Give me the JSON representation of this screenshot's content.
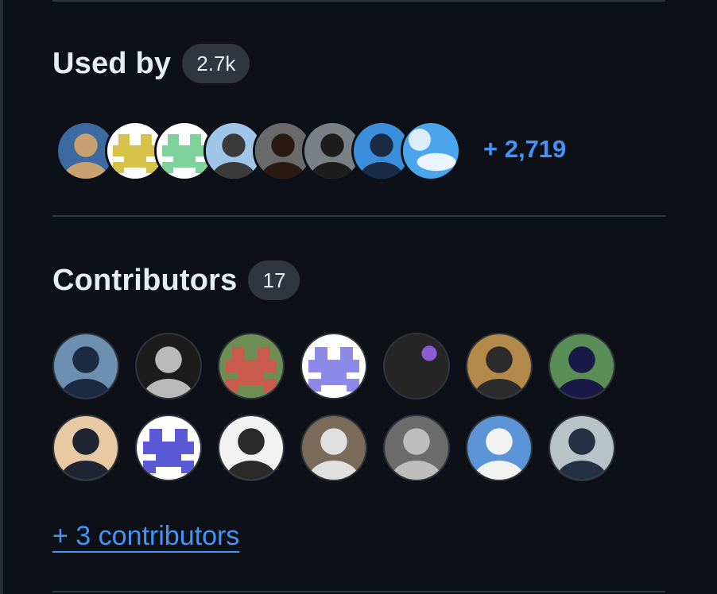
{
  "used_by": {
    "title": "Used by",
    "count_badge": "2.7k",
    "more_link": "+ 2,719",
    "avatars": [
      {
        "name": "user-avatar-1",
        "colors": [
          "#3c6aa0",
          "#c9a070"
        ]
      },
      {
        "name": "user-avatar-2",
        "colors": [
          "#ffffff",
          "#d6c24a"
        ]
      },
      {
        "name": "user-avatar-3",
        "colors": [
          "#ffffff",
          "#7fd39a"
        ]
      },
      {
        "name": "user-avatar-4",
        "colors": [
          "#9fc6e8",
          "#3a3a3a"
        ]
      },
      {
        "name": "user-avatar-5",
        "colors": [
          "#6a6a6a",
          "#2a1a12"
        ]
      },
      {
        "name": "user-avatar-6",
        "colors": [
          "#7b7f86",
          "#1d1d1d"
        ]
      },
      {
        "name": "user-avatar-7",
        "colors": [
          "#3a8edb",
          "#1b2b45"
        ]
      },
      {
        "name": "user-avatar-8",
        "colors": [
          "#4aa5ea",
          "#e9f4ff"
        ]
      }
    ]
  },
  "contributors": {
    "title": "Contributors",
    "count_badge": "17",
    "more_link": "+ 3 contributors",
    "avatars": [
      {
        "name": "contributor-avatar-1",
        "colors": [
          "#6d8fb0",
          "#1c2a44"
        ]
      },
      {
        "name": "contributor-avatar-2",
        "colors": [
          "#1c1c1c",
          "#b9b9b9"
        ]
      },
      {
        "name": "contributor-avatar-3",
        "colors": [
          "#6e8e55",
          "#c85b4b"
        ]
      },
      {
        "name": "contributor-avatar-4",
        "colors": [
          "#ffffff",
          "#8c8ae6"
        ]
      },
      {
        "name": "contributor-avatar-5",
        "colors": [
          "#262626",
          "#8a5cd6"
        ]
      },
      {
        "name": "contributor-avatar-6",
        "colors": [
          "#b48a4a",
          "#2b2b2b"
        ]
      },
      {
        "name": "contributor-avatar-7",
        "colors": [
          "#5a8d58",
          "#1a1a46"
        ]
      },
      {
        "name": "contributor-avatar-8",
        "colors": [
          "#e8c9a3",
          "#1f2533"
        ]
      },
      {
        "name": "contributor-avatar-9",
        "colors": [
          "#ffffff",
          "#5a5ad6"
        ]
      },
      {
        "name": "contributor-avatar-10",
        "colors": [
          "#f2f2f2",
          "#2a2a2a"
        ]
      },
      {
        "name": "contributor-avatar-11",
        "colors": [
          "#7a6a5a",
          "#e0e0e0"
        ]
      },
      {
        "name": "contributor-avatar-12",
        "colors": [
          "#6b6b6b",
          "#bdbdbd"
        ]
      },
      {
        "name": "contributor-avatar-13",
        "colors": [
          "#5b95d8",
          "#f2f2f2"
        ]
      },
      {
        "name": "contributor-avatar-14",
        "colors": [
          "#b9c3c7",
          "#243044"
        ]
      }
    ]
  },
  "colors": {
    "background": "#0d1117",
    "text": "#e6edf3",
    "badge": "#30363d",
    "link": "#4493f8",
    "divider": "#30363d"
  }
}
